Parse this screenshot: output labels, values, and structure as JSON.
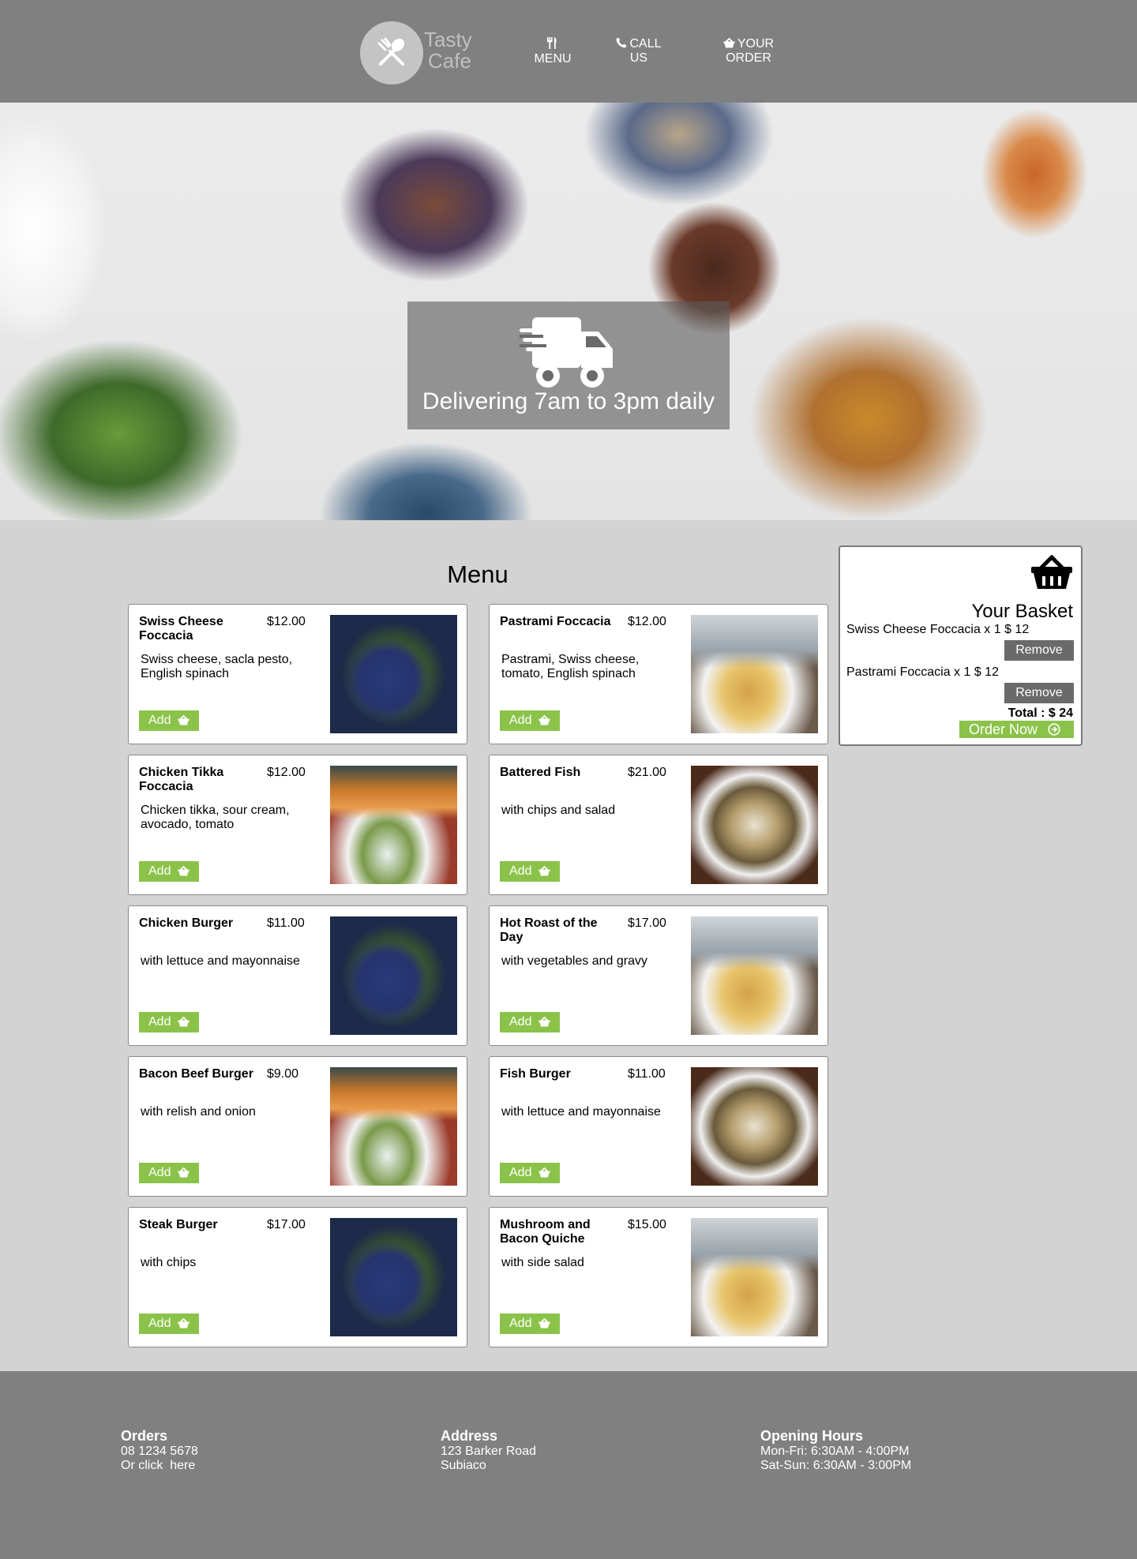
{
  "header": {
    "logo_line1": "Tasty",
    "logo_line2": "Cafe",
    "nav": {
      "menu": "MENU",
      "call_line1": "CALL",
      "call_line2": "US",
      "order_line1": "YOUR",
      "order_line2": "ORDER"
    }
  },
  "hero": {
    "text": "Delivering 7am to 3pm daily",
    "icon": "truck-icon"
  },
  "menu": {
    "title": "Menu",
    "add_label": "Add",
    "items": [
      {
        "name": "Swiss Cheese Foccacia",
        "price": "$12.00",
        "description": "Swiss cheese, sacla pesto, English spinach",
        "image": "salad-bowl-photo"
      },
      {
        "name": "Pastrami Foccacia",
        "price": "$12.00",
        "description": "Pastrami, Swiss cheese, tomato, English spinach",
        "image": "plated-meal-photo"
      },
      {
        "name": "Chicken Tikka Foccacia",
        "price": "$12.00",
        "description": "Chicken tikka, sour cream, avocado, tomato",
        "image": "sushi-edamame-photo"
      },
      {
        "name": "Battered Fish",
        "price": "$21.00",
        "description": "with chips and salad",
        "image": "pasta-bowl-photo"
      },
      {
        "name": "Chicken Burger",
        "price": "$11.00",
        "description": "with lettuce and mayonnaise",
        "image": "salad-bowl-photo"
      },
      {
        "name": "Hot Roast of the Day",
        "price": "$17.00",
        "description": "with vegetables and gravy",
        "image": "plated-meal-photo"
      },
      {
        "name": "Bacon Beef Burger",
        "price": "$9.00",
        "description": "with relish and onion",
        "image": "sushi-edamame-photo"
      },
      {
        "name": "Fish Burger",
        "price": "$11.00",
        "description": "with lettuce and mayonnaise",
        "image": "pasta-bowl-photo"
      },
      {
        "name": "Steak Burger",
        "price": "$17.00",
        "description": "with chips",
        "image": "salad-bowl-photo"
      },
      {
        "name": "Mushroom and Bacon Quiche",
        "price": "$15.00",
        "description": "with side salad",
        "image": "plated-meal-photo"
      }
    ]
  },
  "basket": {
    "title": "Your Basket",
    "lines": [
      {
        "text": "Swiss Cheese Foccacia x 1 $ 12",
        "remove_label": "Remove"
      },
      {
        "text": "Pastrami Foccacia x 1 $ 12",
        "remove_label": "Remove"
      }
    ],
    "total": "Total : $ 24",
    "order_label": "Order Now"
  },
  "footer": {
    "orders": {
      "heading": "Orders",
      "line1": "08 1234 5678",
      "line2": "Or click  here"
    },
    "address": {
      "heading": "Address",
      "line1": "123 Barker Road",
      "line2": "Subiaco"
    },
    "hours": {
      "heading": "Opening Hours",
      "line1": "Mon-Fri: 6:30AM - 4:00PM",
      "line2": "Sat-Sun: 6:30AM - 3:00PM"
    }
  },
  "colors": {
    "header_bg": "#808080",
    "page_bg": "#d3d3d3",
    "accent_green": "#8bc34a",
    "remove_btn": "#6a6a6a"
  }
}
